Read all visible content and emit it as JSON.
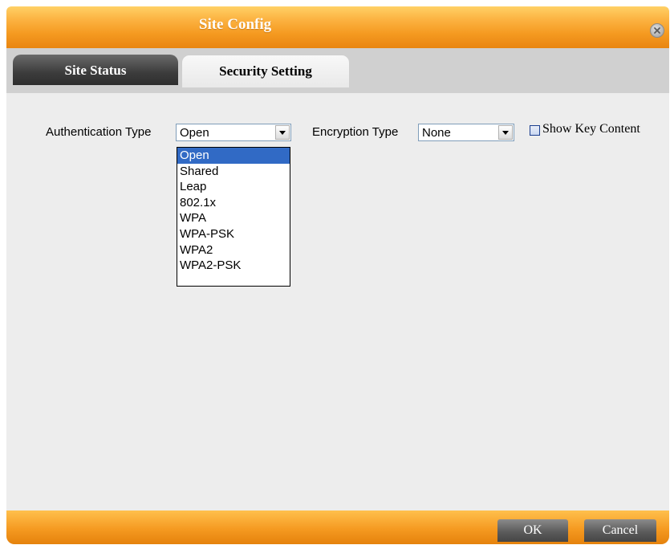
{
  "window": {
    "title": "Site Config"
  },
  "tabs": [
    {
      "label": "Site Status",
      "active": false
    },
    {
      "label": "Security Setting",
      "active": true
    }
  ],
  "security": {
    "authentication": {
      "label": "Authentication Type",
      "value": "Open",
      "options": [
        "Open",
        "Shared",
        "Leap",
        "802.1x",
        "WPA",
        "WPA-PSK",
        "WPA2",
        "WPA2-PSK"
      ],
      "highlighted": "Open"
    },
    "encryption": {
      "label": "Encryption Type",
      "value": "None"
    },
    "show_key": {
      "label": "Show Key Content",
      "checked": false
    }
  },
  "footer": {
    "ok_label": "OK",
    "cancel_label": "Cancel"
  },
  "colors": {
    "title_bar": "#f5a11f",
    "selection": "#316ac5",
    "button": "#5c5c5c"
  }
}
